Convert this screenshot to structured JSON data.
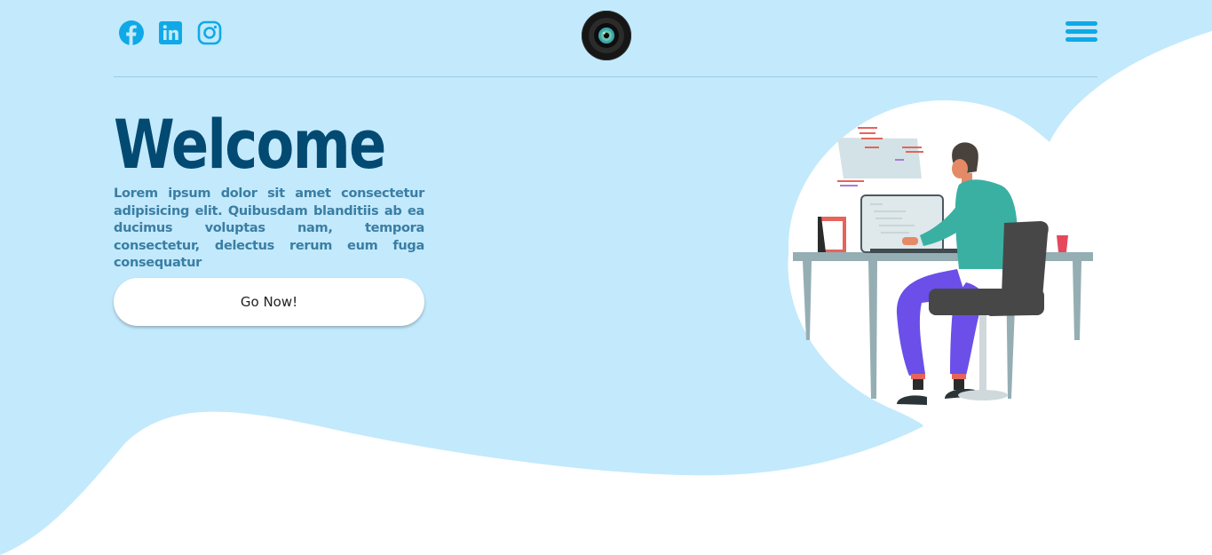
{
  "header": {
    "social_icons": [
      "facebook-icon",
      "linkedin-icon",
      "instagram-icon"
    ],
    "logo_icon": "camera-lens-logo",
    "menu_icon": "hamburger-menu-icon"
  },
  "hero": {
    "title": "Welcome",
    "description": "Lorem ipsum dolor sit amet consectetur adipisicing elit. Quibusdam blanditiis ab ea ducimus voluptas nam, tempora consectetur, delectus rerum eum fuga consequatur",
    "button_label": "Go Now!"
  },
  "illustration": "person-working-at-laptop-desk",
  "colors": {
    "background_blue": "#c3e9fc",
    "title": "#034a72",
    "description": "#3a7ea3",
    "icon_accent": "#0fa9e8"
  }
}
